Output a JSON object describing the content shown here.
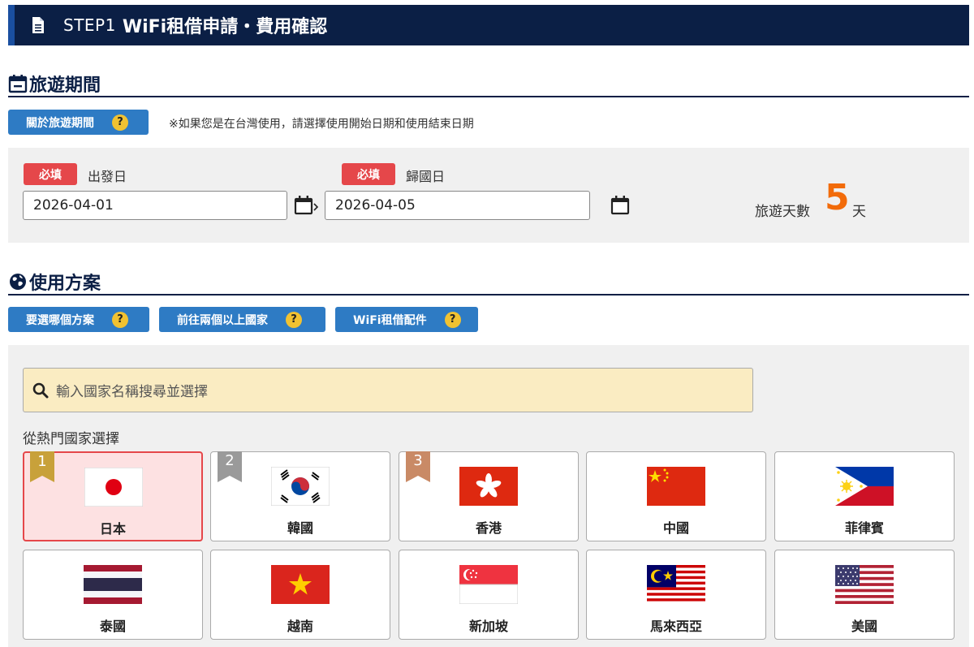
{
  "header": {
    "step": "STEP1",
    "title": "WiFi租借申請・費用確認"
  },
  "travel": {
    "title": "旅遊期間",
    "help_button": "關於旅遊期間",
    "note": "※如果您是在台灣使用，請選擇使用開始日期和使用結束日期",
    "required_label": "必填",
    "departure_label": "出發日",
    "departure_value": "2026-04-01",
    "return_label": "歸國日",
    "return_value": "2026-04-05",
    "days_label": "旅遊天數",
    "days_value": "5",
    "days_unit": "天"
  },
  "plan": {
    "title": "使用方案",
    "help_buttons": [
      "要選哪個方案",
      "前往兩個以上國家",
      "WiFi租借配件"
    ],
    "search_placeholder": "輸入國家名稱搜尋並選擇",
    "popular_label": "從熱門國家選擇",
    "countries": [
      {
        "name": "日本",
        "rank": "1",
        "selected": true
      },
      {
        "name": "韓國",
        "rank": "2"
      },
      {
        "name": "香港",
        "rank": "3"
      },
      {
        "name": "中國"
      },
      {
        "name": "菲律賓"
      },
      {
        "name": "泰國"
      },
      {
        "name": "越南"
      },
      {
        "name": "新加坡"
      },
      {
        "name": "馬來西亞"
      },
      {
        "name": "美國"
      }
    ]
  },
  "colors": {
    "navy": "#0b1f45",
    "button_blue": "#2e7bc4",
    "required_red": "#e5474a",
    "days_orange": "#f26b0a",
    "search_bg": "#faecc2",
    "rank1": "#c8a13a",
    "rank2": "#9a9a9a",
    "rank3": "#c98a66"
  },
  "icons": {
    "header": "document-icon",
    "travel": "calendar-icon",
    "plan": "globe-icon",
    "search": "search-icon"
  }
}
